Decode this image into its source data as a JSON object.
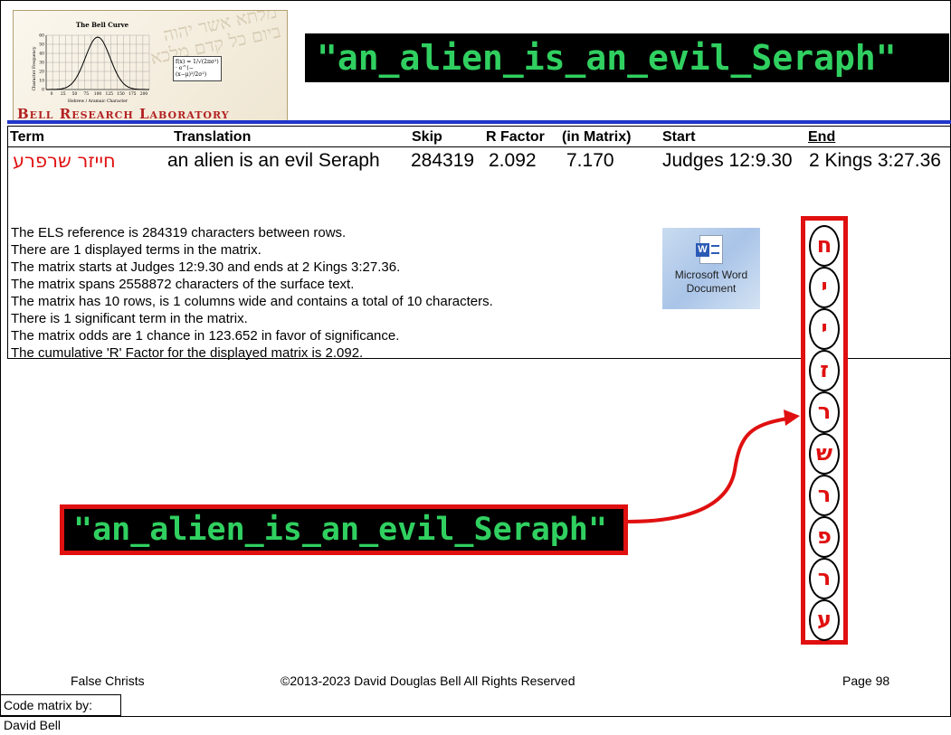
{
  "logo": {
    "chart_title": "The Bell Curve",
    "y_axis_label": "Character Frequency",
    "x_axis_label": "Hebrew / Aramaic Character",
    "x_ticks": [
      "0",
      "25",
      "50",
      "75",
      "100",
      "125",
      "150",
      "175",
      "200"
    ],
    "y_ticks": [
      "60",
      "50",
      "40",
      "30",
      "20",
      "10",
      "0"
    ],
    "formula": "f(x) = 1/√(2πσ²) · e^(−(x−μ)²/2σ²)",
    "name": "Bell Research Laboratory"
  },
  "headline": "\"an_alien_is_an_evil_Seraph\"",
  "table": {
    "headers": {
      "term": "Term",
      "translation": "Translation",
      "skip": "Skip",
      "rfactor": "R Factor",
      "in_matrix": "(in Matrix)",
      "start": "Start",
      "end": "End"
    },
    "row": {
      "term": "חייזר שרפרע",
      "translation": "an alien is an evil Seraph",
      "skip": "284319",
      "rfactor": "2.092",
      "in_matrix": "7.170",
      "start": "Judges 12:9.30",
      "end": "2 Kings 3:27.36"
    }
  },
  "info_lines": [
    "The ELS reference is 284319 characters between rows.",
    "There are 1 displayed terms in the matrix.",
    "The matrix starts at Judges 12:9.30 and ends at 2 Kings 3:27.36.",
    "The matrix spans 2558872 characters of the surface text.",
    "The matrix has 10 rows, is 1 columns wide and contains a total of 10 characters.",
    "There is 1 significant term in the matrix.",
    "The matrix odds are 1 chance in 123.652 in favor of significance.",
    "The cumulative 'R' Factor for the displayed matrix is 2.092."
  ],
  "word_icon": {
    "icon": "word-document-icon",
    "badge": "W",
    "label": "Microsoft Word Document"
  },
  "matrix_letters": [
    "ח",
    "י",
    "י",
    "ז",
    "ר",
    "ש",
    "ר",
    "פ",
    "ר",
    "ע"
  ],
  "callout": "\"an_alien_is_an_evil_Seraph\"",
  "footer": {
    "left": "False Christs",
    "center": "©2013-2023 David Douglas Bell All Rights Reserved",
    "right": "Page 98"
  },
  "credit": "Code matrix by: David Bell",
  "colors": {
    "accent_red": "#e01010",
    "banner_green": "#30d060",
    "rule_blue": "#2035c8"
  }
}
